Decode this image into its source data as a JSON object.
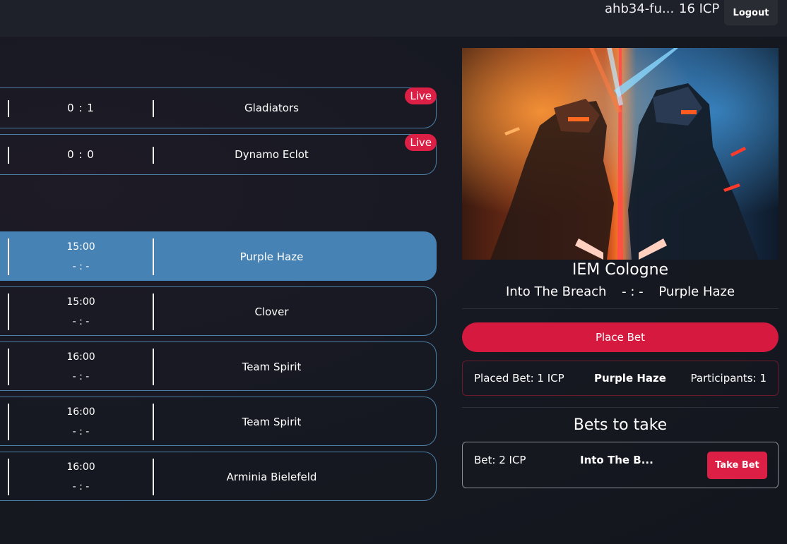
{
  "header": {
    "user_name": "ahb34-fu...",
    "balance": "16 ICP",
    "logout_label": "Logout"
  },
  "live_matches": [
    {
      "score": "0 : 1",
      "team": "Gladiators",
      "badge": "Live"
    },
    {
      "score": "0 : 0",
      "team": "Dynamo Eclot",
      "badge": "Live"
    }
  ],
  "upcoming_matches": [
    {
      "time": "15:00",
      "score": "- : -",
      "team": "Purple Haze",
      "selected": true
    },
    {
      "time": "15:00",
      "score": "- : -",
      "team": "Clover",
      "selected": false
    },
    {
      "time": "16:00",
      "score": "- : -",
      "team": "Team Spirit",
      "selected": false
    },
    {
      "time": "16:00",
      "score": "- : -",
      "team": "Team Spirit",
      "selected": false
    },
    {
      "time": "16:00",
      "score": "- : -",
      "team": "Arminia Bielefeld",
      "selected": false
    }
  ],
  "detail": {
    "event_title": "IEM Cologne",
    "team_a": "Into The Breach",
    "score": "- : -",
    "team_b": "Purple Haze",
    "place_bet_label": "Place Bet",
    "placed_bet": {
      "amount": "Placed Bet: 1 ICP",
      "pick": "Purple Haze",
      "participants": "Participants: 1"
    },
    "bets_title": "Bets to take",
    "bets": [
      {
        "amount": "Bet: 2 ICP",
        "pick": "Into The B...",
        "action_label": "Take Bet"
      }
    ]
  },
  "colors": {
    "accent_red": "#dc1f45",
    "selected_blue": "#4682b4",
    "card_border": "#4c7fa6",
    "background": "#161821"
  },
  "icons": {
    "event_artwork": "cyber-warriors-artwork"
  }
}
